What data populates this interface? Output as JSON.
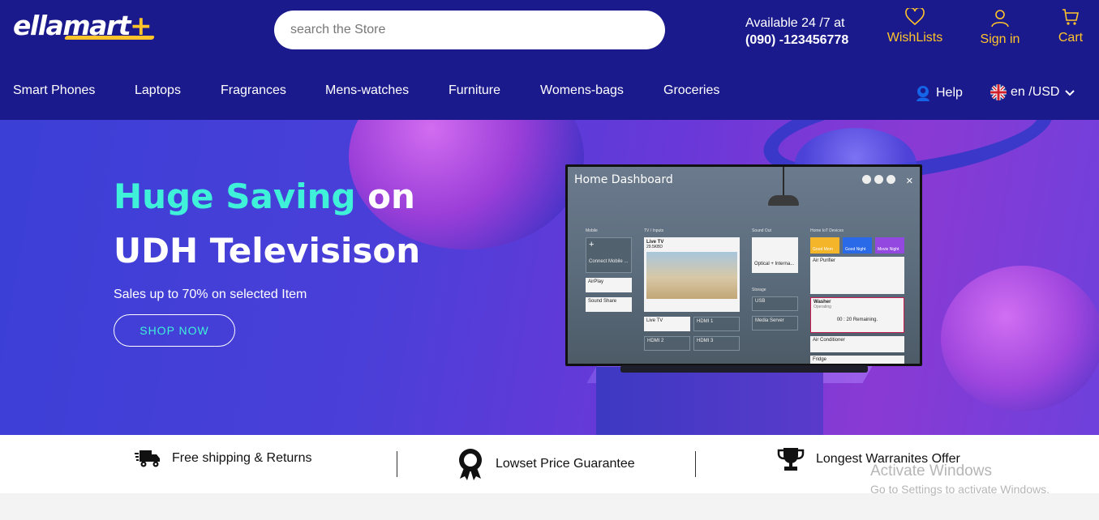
{
  "header": {
    "logo_text": "ellamart",
    "logo_plus": "+",
    "search_placeholder": "search the Store",
    "availability": "Available 24 /7 at",
    "phone": "(090) -123456778",
    "wishlist_label": "WishLists",
    "signin_label": "Sign in",
    "cart_label": "Cart"
  },
  "nav": {
    "items": [
      {
        "label": "Smart Phones"
      },
      {
        "label": "Laptops"
      },
      {
        "label": "Fragrances"
      },
      {
        "label": "Mens-watches"
      },
      {
        "label": "Furniture"
      },
      {
        "label": "Womens-bags"
      },
      {
        "label": "Groceries"
      }
    ],
    "help_label": "Help",
    "locale_label": "en /USD"
  },
  "hero": {
    "title_accent": "Huge Saving",
    "title_rest": " on",
    "title_line2": "UDH Televisison",
    "subtitle": "Sales up to 70% on selected Item",
    "cta": "SHOP NOW",
    "tv": {
      "dashboard_title": "Home Dashboard",
      "col_mobile": "Mobile",
      "col_tv": "TV / Inputs",
      "col_sound": "Sound Out",
      "col_iot": "Home IoT Devices",
      "connect_mobile": "Connect Mobile ...",
      "airplay": "AirPlay",
      "sound_share": "Sound Share",
      "live_tv": "Live TV",
      "channel": "29.5KBD",
      "hdmi1": "HDMI 1",
      "hdmi2": "HDMI 2",
      "hdmi3": "HDMI 3",
      "optical": "Optical + Interna...",
      "storage": "Storage",
      "usb": "USB",
      "media_server": "Media Server",
      "good_morning": "Good Morn",
      "good_night": "Good Night",
      "movie_night": "Movie Night",
      "air_purifier": "Air Purifier",
      "washer": "Washer",
      "operating": "Operating",
      "remaining": "00 : 20 Remaining.",
      "air_conditioner": "Air Conditioner",
      "fridge": "Fridge"
    }
  },
  "features": {
    "shipping": "Free shipping & Returns",
    "price": "Lowset Price Guarantee",
    "warranty": "Longest Warranites Offer"
  },
  "overlay": {
    "activate_title": "Activate Windows",
    "activate_sub": "Go to Settings to activate Windows."
  },
  "colors": {
    "header_bg": "#1b1a8c",
    "accent_yellow": "#ffc42a",
    "accent_cyan": "#3ff1d8"
  }
}
